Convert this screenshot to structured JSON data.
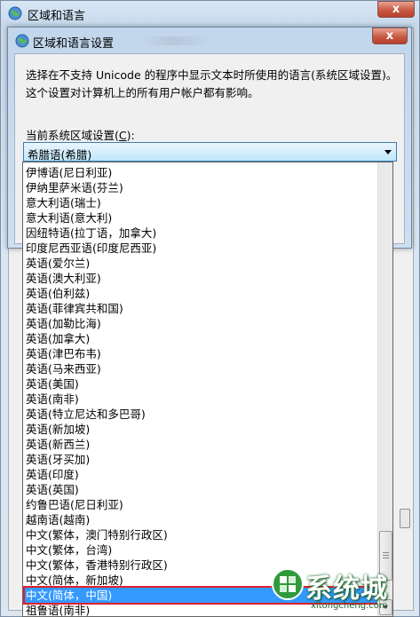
{
  "outer_window": {
    "title": "区域和语言",
    "close_label": "x"
  },
  "dialog": {
    "title": "区域和语言设置",
    "close_label": "x",
    "description": "选择在不支持 Unicode 的程序中显示文本时所使用的语言(系统区域设置)。这个设置对计算机上的所有用户帐户都有影响。",
    "locale_label_prefix": "当前系统区域设置(",
    "locale_label_key": "C",
    "locale_label_suffix": "):",
    "combo_value": "希腊语(希腊)"
  },
  "dropdown": {
    "items": [
      "伊博语(尼日利亚)",
      "伊纳里萨米语(芬兰)",
      "意大利语(瑞士)",
      "意大利语(意大利)",
      "因纽特语(拉丁语，加拿大)",
      "印度尼西亚语(印度尼西亚)",
      "英语(爱尔兰)",
      "英语(澳大利亚)",
      "英语(伯利兹)",
      "英语(菲律宾共和国)",
      "英语(加勒比海)",
      "英语(加拿大)",
      "英语(津巴布韦)",
      "英语(马来西亚)",
      "英语(美国)",
      "英语(南非)",
      "英语(特立尼达和多巴哥)",
      "英语(新加坡)",
      "英语(新西兰)",
      "英语(牙买加)",
      "英语(印度)",
      "英语(英国)",
      "约鲁巴语(尼日利亚)",
      "越南语(越南)",
      "中文(繁体，澳门特别行政区)",
      "中文(繁体，台湾)",
      "中文(繁体，香港特别行政区)",
      "中文(简体，新加坡)",
      "中文(简体，中国)",
      "祖鲁语(南非)"
    ],
    "selected_index": 28
  },
  "watermark": {
    "text": "系统城",
    "url": "xitongcheng.com"
  },
  "colors": {
    "selection": "#3399ff",
    "highlight_border": "#e0202a",
    "combo_border": "#3c7fb1"
  }
}
